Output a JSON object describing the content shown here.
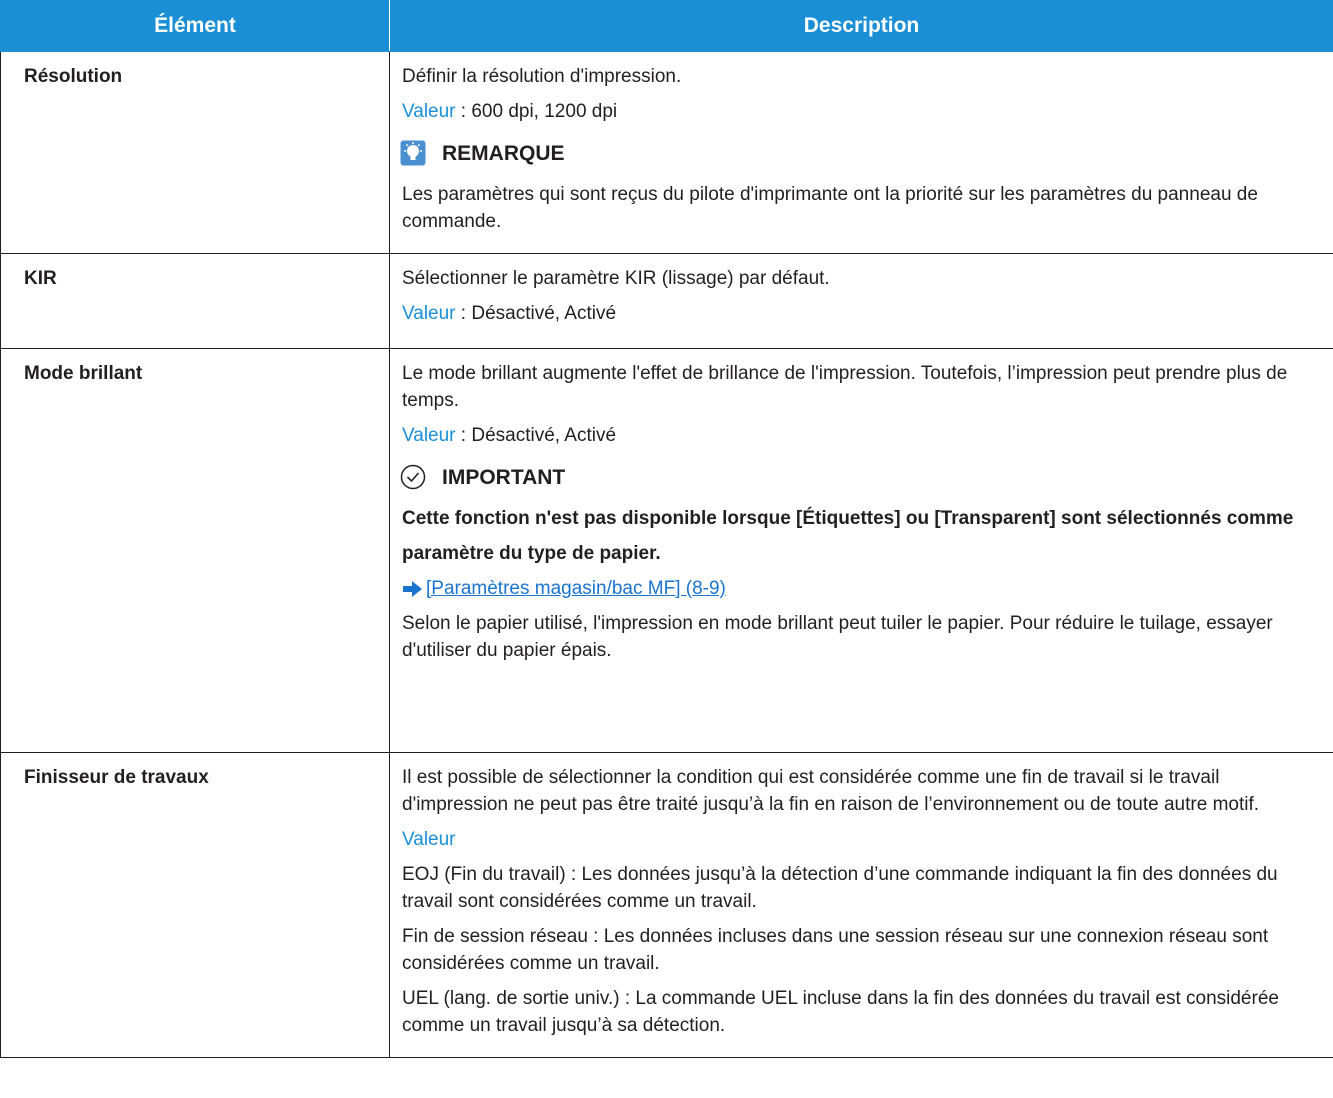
{
  "header": {
    "col_item": "Élément",
    "col_desc": "Description"
  },
  "rows": [
    {
      "item": "Résolution",
      "desc": "Définir la résolution d'impression.",
      "value_label": "Valeur",
      "value_text": " : 600 dpi, 1200 dpi",
      "note_title": "REMARQUE",
      "note_text": "Les paramètres qui sont reçus du pilote d'imprimante ont la priorité sur les paramètres du panneau de commande."
    },
    {
      "item": "KIR",
      "desc": "Sélectionner le paramètre KIR (lissage) par défaut.",
      "value_label": "Valeur",
      "value_text": " : Désactivé, Activé"
    },
    {
      "item": "Mode brillant",
      "desc": "Le mode brillant augmente l'effet de brillance de l'impression. Toutefois, l’impression peut prendre plus de temps.",
      "value_label": "Valeur",
      "value_text": " : Désactivé, Activé",
      "important_title": "IMPORTANT",
      "important_line1": "Cette fonction n'est pas disponible lorsque [Étiquettes] ou [Transparent] sont sélectionnés comme",
      "important_line2": "paramètre du type de papier.",
      "link_text": "[Paramètres magasin/bac MF] (8-9)",
      "extra_text": "Selon le papier utilisé, l'impression en mode brillant peut tuiler le papier. Pour réduire le tuilage, essayer d'utiliser du papier épais."
    },
    {
      "item": "Finisseur de travaux",
      "desc": "Il est possible de sélectionner la condition qui est considérée comme une fin de travail si le travail d'impression ne peut pas être traité jusqu’à la fin en raison de l’environnement ou de toute autre motif.",
      "value_label": "Valeur",
      "opt1": "EOJ (Fin du travail) : Les données jusqu’à la détection d’une commande indiquant la fin des données du travail sont considérées comme un travail.",
      "opt2": "Fin de session réseau : Les données incluses dans une session réseau sur une connexion réseau sont considérées comme un travail.",
      "opt3": "UEL (lang. de sortie univ.) : La commande UEL incluse dans la fin des données du travail est considérée comme un travail jusqu’à sa détection."
    }
  ],
  "colors": {
    "header_bg": "#1a8fd6",
    "value_label": "#1a8fd6",
    "link": "#1a75d0"
  }
}
